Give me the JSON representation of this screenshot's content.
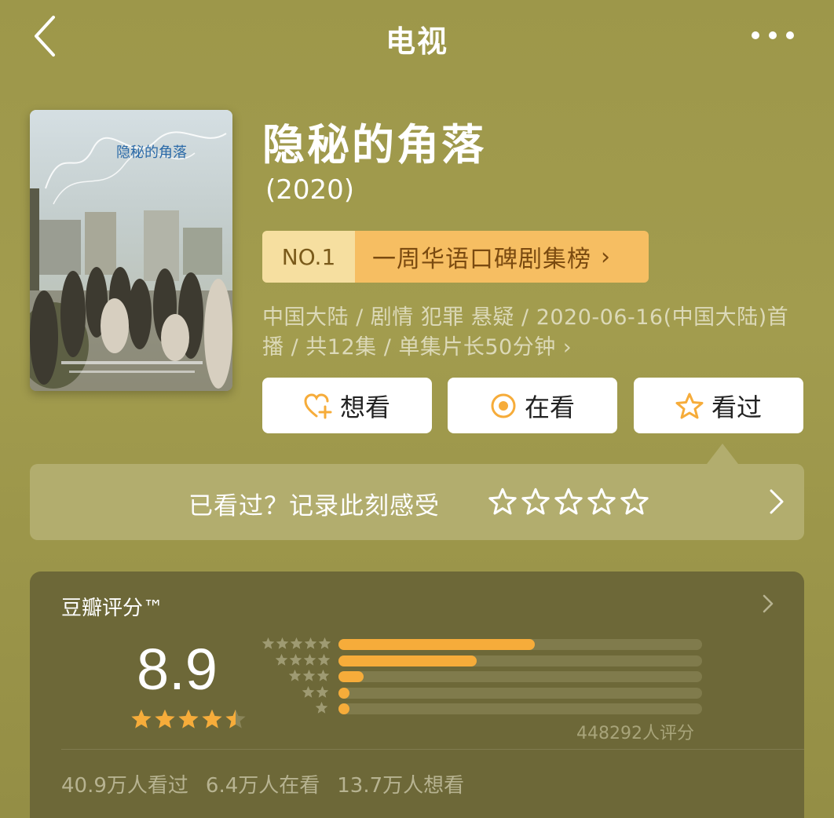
{
  "nav": {
    "title": "电视"
  },
  "poster": {
    "alt": "隐秘的角落"
  },
  "show": {
    "title": "隐秘的角落",
    "year": "(2020)",
    "rank_no": "NO.1",
    "rank_label": "一周华语口碑剧集榜",
    "meta_line1": "中国大陆 / 剧情 犯罪 悬疑 / 2020-06-16(中国大陆)首",
    "meta_line2": "播 / 共12集 / 单集片长50分钟"
  },
  "actions": {
    "want": "想看",
    "watching": "在看",
    "watched": "看过"
  },
  "record": {
    "prompt": "已看过？记录此刻感受",
    "stars_count": 5
  },
  "score": {
    "title": "豆瓣评分™",
    "value": "8.9",
    "stars": 4.5,
    "distribution": [
      {
        "stars": 5,
        "fraction": 0.54
      },
      {
        "stars": 4,
        "fraction": 0.38
      },
      {
        "stars": 3,
        "fraction": 0.07
      },
      {
        "stars": 2,
        "fraction": 0.03
      },
      {
        "stars": 1,
        "fraction": 0.03
      }
    ],
    "rating_count": "448292人评分",
    "watched": "40.9万人看过",
    "watching": "6.4万人在看",
    "want": "13.7万人想看"
  },
  "colors": {
    "background": "#a09a4c",
    "accent_orange": "#f6ac3a",
    "rank_badge": "#f6be62"
  }
}
